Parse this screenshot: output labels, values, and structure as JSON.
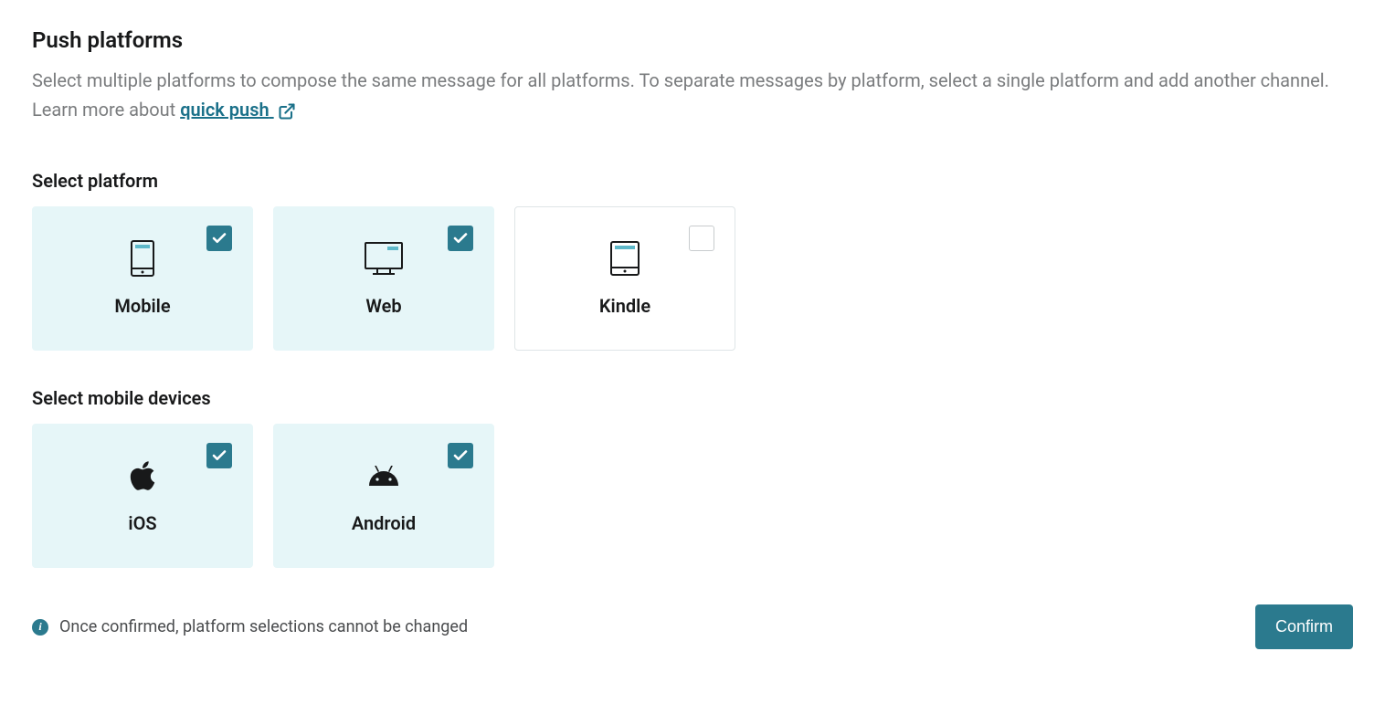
{
  "header": {
    "title": "Push platforms",
    "description_prefix": "Select multiple platforms to compose the same message for all platforms. To separate messages by platform, select a single platform and add another channel. Learn more about ",
    "link_text": "quick push"
  },
  "sections": {
    "platform": {
      "heading": "Select platform",
      "cards": [
        {
          "label": "Mobile",
          "selected": true,
          "icon": "mobile"
        },
        {
          "label": "Web",
          "selected": true,
          "icon": "web"
        },
        {
          "label": "Kindle",
          "selected": false,
          "icon": "kindle"
        }
      ]
    },
    "devices": {
      "heading": "Select mobile devices",
      "cards": [
        {
          "label": "iOS",
          "selected": true,
          "icon": "ios"
        },
        {
          "label": "Android",
          "selected": true,
          "icon": "android"
        }
      ]
    }
  },
  "footer": {
    "note": "Once confirmed, platform selections cannot be changed",
    "confirm_label": "Confirm"
  },
  "colors": {
    "accent": "#2b7a8e",
    "selected_bg": "#e6f6f8",
    "text_muted": "#7a7c7e",
    "icon_accent": "#5eb8c9"
  }
}
